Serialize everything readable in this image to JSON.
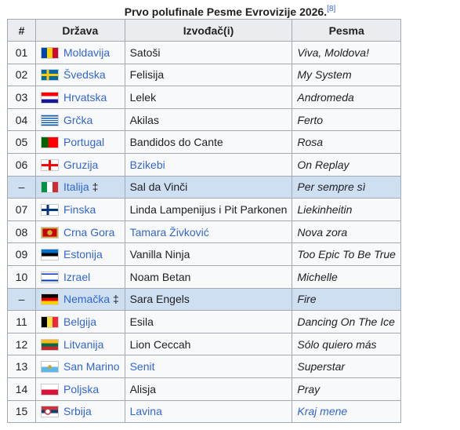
{
  "caption": {
    "title": "Prvo polufinale Pesme Evrovizije 2026.",
    "ref": "[8]"
  },
  "headers": {
    "num": "#",
    "country": "Država",
    "artist": "Izvođač(i)",
    "song": "Pesma"
  },
  "rows": [
    {
      "num": "01",
      "flag": "moldova-flag",
      "flag_class": "f-md",
      "country": "Moldavija",
      "marker": "",
      "artist": "Satoši",
      "song": "Viva, Moldova!",
      "auto": false
    },
    {
      "num": "02",
      "flag": "sweden-flag",
      "flag_class": "f-se",
      "country": "Švedska",
      "marker": "",
      "artist": "Felisija",
      "song": "My System",
      "auto": false
    },
    {
      "num": "03",
      "flag": "croatia-flag",
      "flag_class": "f-hr",
      "country": "Hrvatska",
      "marker": "",
      "artist": "Lelek",
      "song": "Andromeda",
      "auto": false
    },
    {
      "num": "04",
      "flag": "greece-flag",
      "flag_class": "f-gr",
      "country": "Grčka",
      "marker": "",
      "artist": "Akilas",
      "song": "Ferto",
      "auto": false
    },
    {
      "num": "05",
      "flag": "portugal-flag",
      "flag_class": "f-pt",
      "country": "Portugal",
      "marker": "",
      "artist": "Bandidos do Cante",
      "song": "Rosa",
      "auto": false
    },
    {
      "num": "06",
      "flag": "georgia-flag",
      "flag_class": "f-ge",
      "country": "Gruzija",
      "marker": "",
      "artist": "Bzikebi",
      "artist_link": true,
      "song": "On Replay",
      "auto": false
    },
    {
      "num": "–",
      "flag": "italy-flag",
      "flag_class": "f-it",
      "country": "Italija",
      "marker": "‡",
      "artist": "Sal da Vinči",
      "song": "Per sempre sì",
      "auto": true
    },
    {
      "num": "07",
      "flag": "finland-flag",
      "flag_class": "f-fi",
      "country": "Finska",
      "marker": "",
      "artist": "Linda Lampenijus i Pit Parkonen",
      "song": "Liekinheitin",
      "auto": false
    },
    {
      "num": "08",
      "flag": "montenegro-flag",
      "flag_class": "f-me",
      "country": "Crna Gora",
      "marker": "",
      "artist": "Tamara Živković",
      "artist_link": true,
      "song": "Nova zora",
      "auto": false
    },
    {
      "num": "09",
      "flag": "estonia-flag",
      "flag_class": "f-ee",
      "country": "Estonija",
      "marker": "",
      "artist": "Vanilla Ninja",
      "song": "Too Epic To Be True",
      "auto": false
    },
    {
      "num": "10",
      "flag": "israel-flag",
      "flag_class": "f-il",
      "country": "Izrael",
      "marker": "",
      "artist": "Noam Betan",
      "song": "Michelle",
      "auto": false
    },
    {
      "num": "–",
      "flag": "germany-flag",
      "flag_class": "f-de",
      "country": "Nemačka",
      "marker": "‡",
      "artist": "Sara Engels",
      "song": "Fire",
      "auto": true
    },
    {
      "num": "11",
      "flag": "belgium-flag",
      "flag_class": "f-be",
      "country": "Belgija",
      "marker": "",
      "artist": "Esila",
      "song": "Dancing On The Ice",
      "auto": false
    },
    {
      "num": "12",
      "flag": "lithuania-flag",
      "flag_class": "f-lt",
      "country": "Litvanija",
      "marker": "",
      "artist": "Lion Ceccah",
      "song": "Sólo quiero más",
      "auto": false
    },
    {
      "num": "13",
      "flag": "san-marino-flag",
      "flag_class": "f-sm",
      "country": "San Marino",
      "marker": "",
      "artist": "Senit",
      "artist_link": true,
      "song": "Superstar",
      "auto": false
    },
    {
      "num": "14",
      "flag": "poland-flag",
      "flag_class": "f-pl",
      "country": "Poljska",
      "marker": "",
      "artist": "Alisja",
      "song": "Pray",
      "auto": false
    },
    {
      "num": "15",
      "flag": "serbia-flag",
      "flag_class": "f-rs",
      "country": "Srbija",
      "marker": "",
      "artist": "Lavina",
      "artist_link": true,
      "song": "Kraj mene",
      "song_link": true,
      "auto": false
    }
  ],
  "colors": {
    "link": "#3366cc",
    "header_bg": "#eaecf0",
    "row_bg": "#f8f9fa",
    "auto_row_bg": "#cedff2",
    "border": "#a2a9b1"
  }
}
